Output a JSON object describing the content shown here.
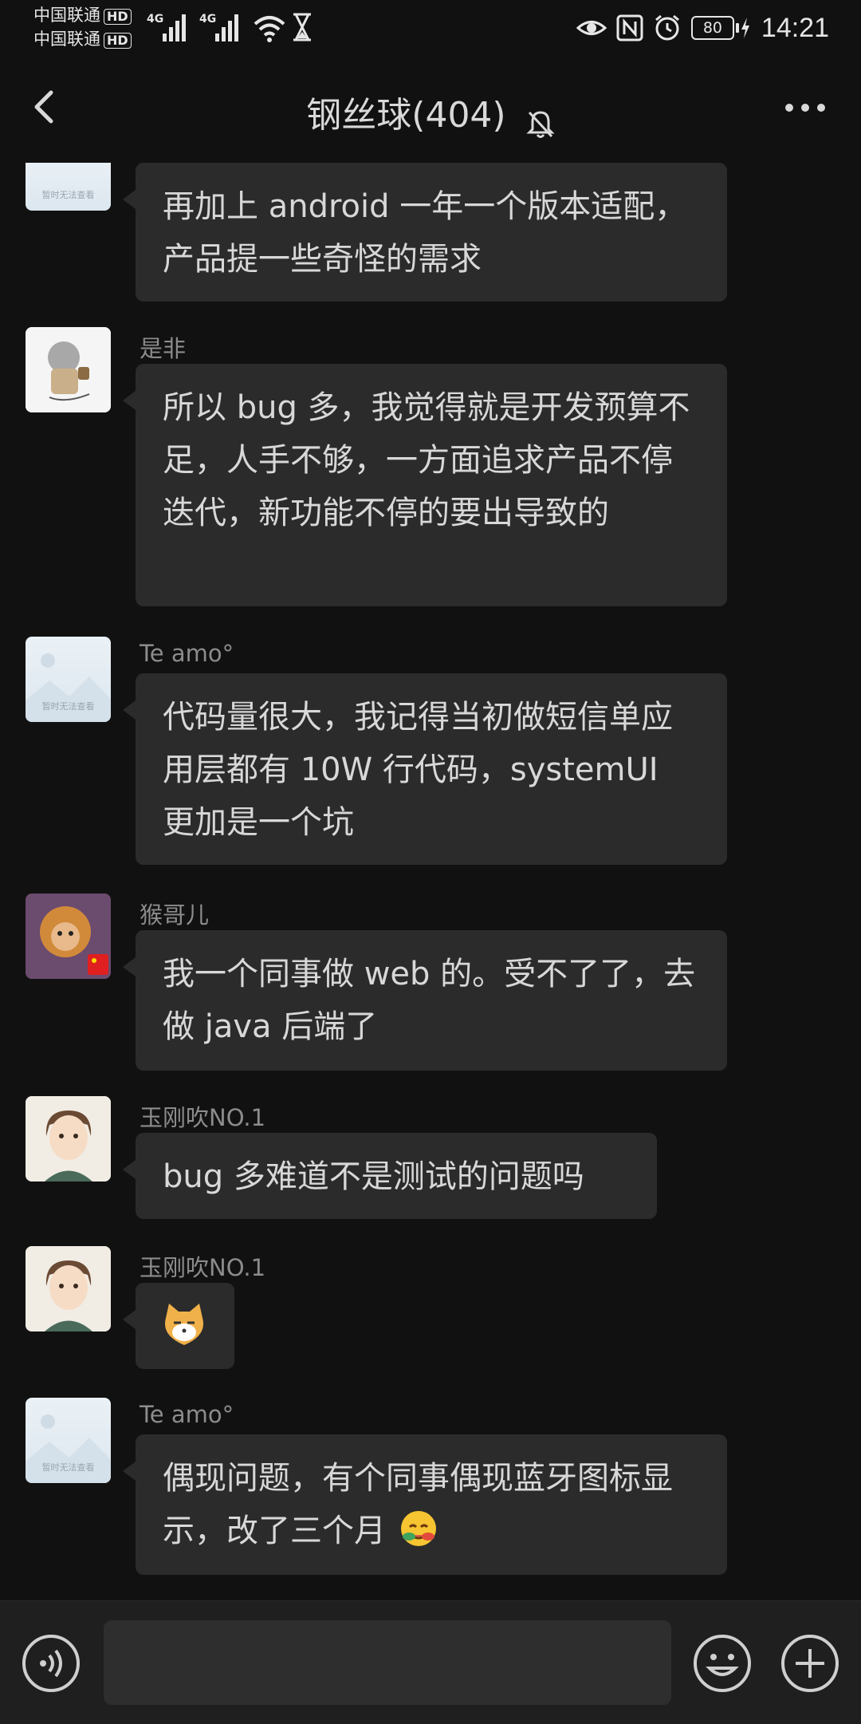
{
  "status_bar": {
    "carrier1": "中国联通",
    "carrier2": "中国联通",
    "hd": "HD",
    "net1": "4G",
    "net2": "4G",
    "battery": "80",
    "time": "14:21"
  },
  "header": {
    "title": "钢丝球(404)"
  },
  "messages": [
    {
      "sender": "",
      "avatar": "placeholder",
      "text": "再加上 android 一年一个版本适配，产品提一些奇怪的需求"
    },
    {
      "sender": "是非",
      "avatar": "knight",
      "text": "所以 bug 多，我觉得就是开发预算不足，人手不够，一方面追求产品不停迭代，新功能不停的要出导致的"
    },
    {
      "sender": "Te amo°",
      "avatar": "placeholder",
      "text": "代码量很大，我记得当初做短信单应用层都有 10W 行代码，systemUI 更加是一个坑"
    },
    {
      "sender": "猴哥儿",
      "avatar": "monkey",
      "text": "我一个同事做 web 的。受不了了，去做 java 后端了"
    },
    {
      "sender": "玉刚吹NO.1",
      "avatar": "boy",
      "text": "bug 多难道不是测试的问题吗"
    },
    {
      "sender": "玉刚吹NO.1",
      "avatar": "boy",
      "text": "",
      "sticker": "cat-face"
    },
    {
      "sender": "Te amo°",
      "avatar": "placeholder",
      "text": "偶现问题，有个同事偶现蓝牙图标显示，改了三个月",
      "trailing_emoji": "sweat-smile-emoji"
    }
  ],
  "input": {
    "placeholder": ""
  },
  "placeholder_caption": "暂时无法查看"
}
